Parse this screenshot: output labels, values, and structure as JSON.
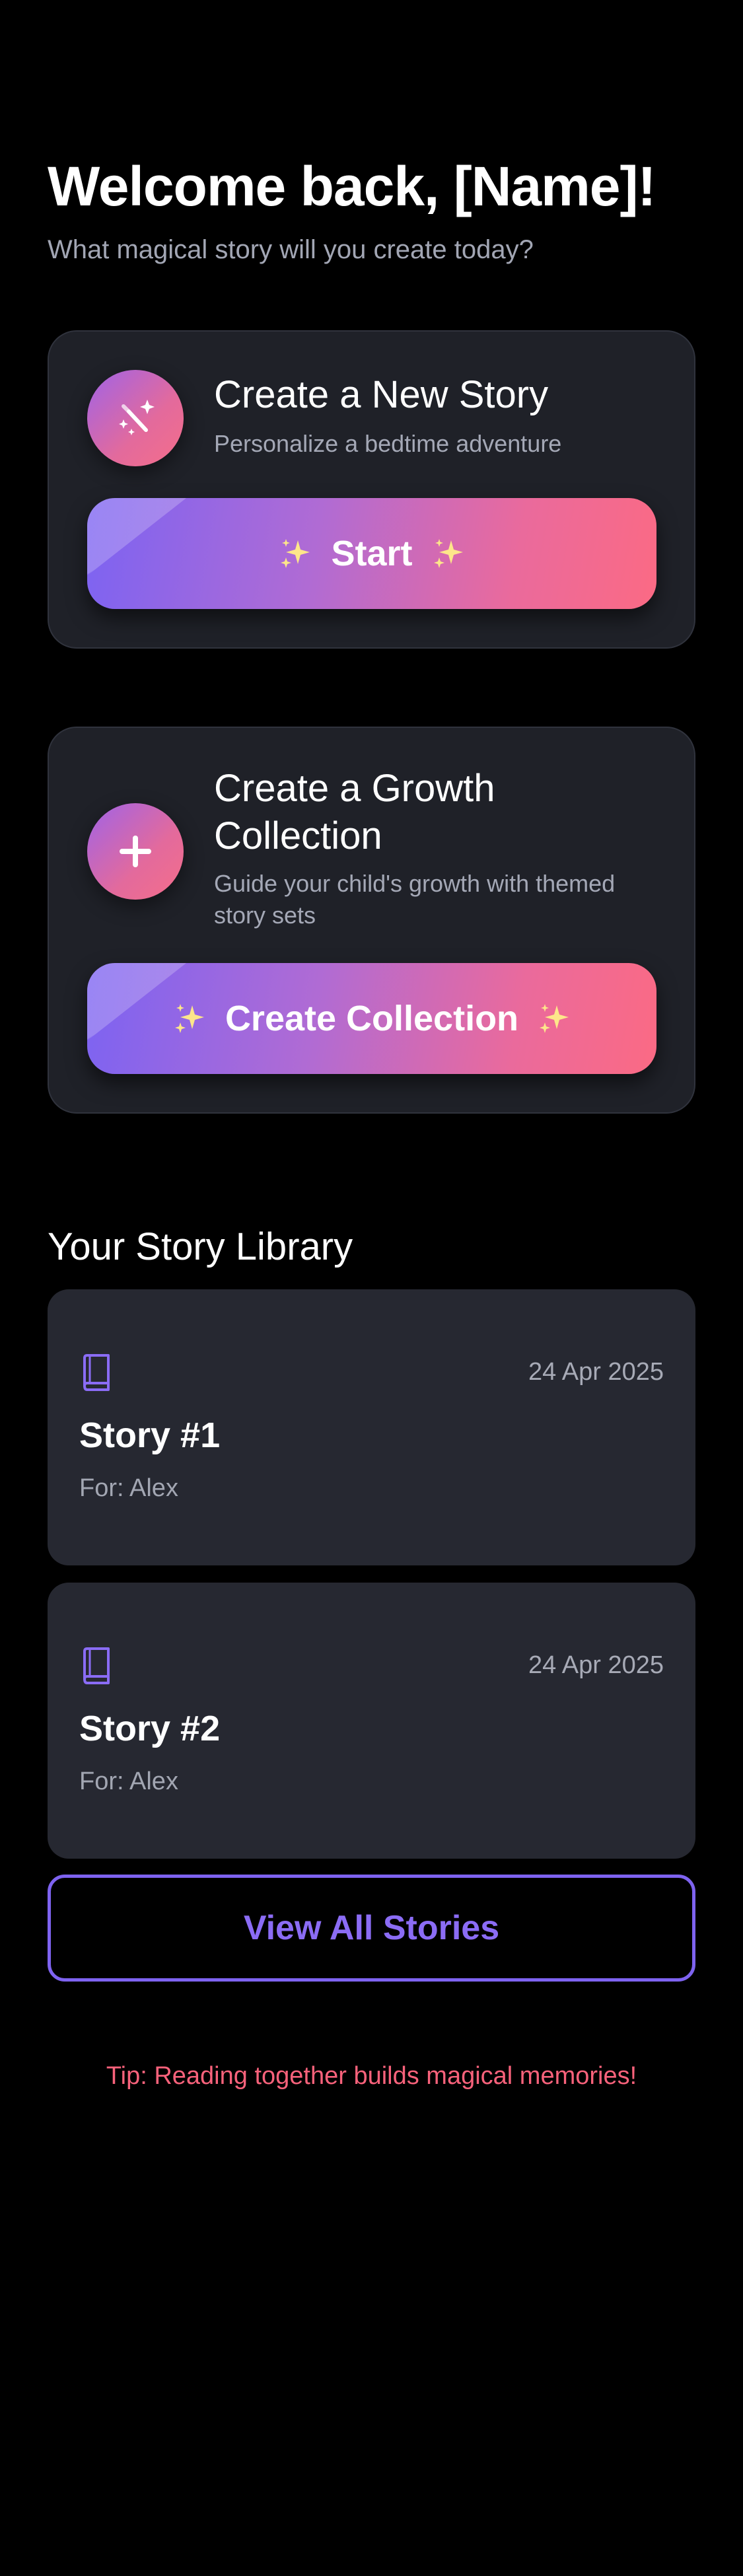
{
  "header": {
    "title": "Welcome back, [Name]!",
    "subtitle": "What magical story will you create today?"
  },
  "new_story_card": {
    "icon": "magic-wand-icon",
    "heading": "Create a New Story",
    "description": "Personalize a bedtime adventure",
    "button_label": "Start"
  },
  "growth_card": {
    "icon": "plus-icon",
    "heading": "Create a Growth Collection",
    "description": "Guide your child's growth with themed story sets",
    "button_label": "Create Collection"
  },
  "library": {
    "title": "Your Story Library",
    "stories": [
      {
        "icon": "book-icon",
        "date": "24 Apr 2025",
        "title": "Story #1",
        "for": "For: Alex"
      },
      {
        "icon": "book-icon",
        "date": "24 Apr 2025",
        "title": "Story #2",
        "for": "For: Alex"
      }
    ],
    "view_all_label": "View All Stories"
  },
  "tip": "Tip: Reading together builds magical memories!",
  "colors": {
    "background": "#000000",
    "card": "#1f2128",
    "story_card": "#262831",
    "accent_purple": "#7e63f0",
    "accent_pink": "#fb6a84",
    "tip_red": "#f8627b"
  }
}
